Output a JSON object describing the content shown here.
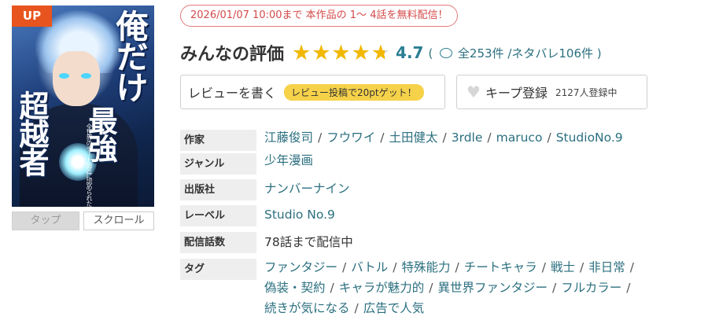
{
  "cover": {
    "badge": "UP",
    "title_parts": [
      "俺だけ",
      "最強",
      "超越者"
    ],
    "subtitle": "全世界のチート師匠に認められた"
  },
  "cover_buttons": {
    "tap": "タップ",
    "scroll": "スクロール"
  },
  "promo": "2026/01/07 10:00まで 本作品の 1～ 4話を無料配信！",
  "rating": {
    "title": "みんなの評価",
    "score": "4.7",
    "stars_fraction": 0.94,
    "open_paren": "(",
    "total": "全253件",
    "spoiler": "/ネタバレ106件",
    "close_paren": ")"
  },
  "review_button": {
    "label": "レビューを書く",
    "badge": "レビュー投稿で20ptゲット！"
  },
  "keep_button": {
    "label": "キープ登録",
    "count": "2127人登録中"
  },
  "info": {
    "author_label": "作家",
    "authors": [
      "江藤俊司",
      "フウワイ",
      "土田健太",
      "3rdle",
      "maruco",
      "StudioNo.9"
    ],
    "genre_label": "ジャンル",
    "genre": "少年漫画",
    "publisher_label": "出版社",
    "publisher": "ナンバーナイン",
    "label_label": "レーベル",
    "label": "Studio No.9",
    "episodes_label": "配信話数",
    "episodes": "78話まで配信中",
    "tags_label": "タグ",
    "tags": [
      "ファンタジー",
      "バトル",
      "特殊能力",
      "チートキャラ",
      "戦士",
      "非日常",
      "偽装・契約",
      "キャラが魅力的",
      "異世界ファンタジー",
      "フルカラー",
      "続きが気になる",
      "広告で人気"
    ]
  },
  "colors": {
    "accent_teal": "#2b7e93",
    "promo_red": "#d54a4a",
    "star_gold": "#f2b800",
    "up_badge": "#e8541e",
    "pill_yellow": "#f6d24a"
  }
}
